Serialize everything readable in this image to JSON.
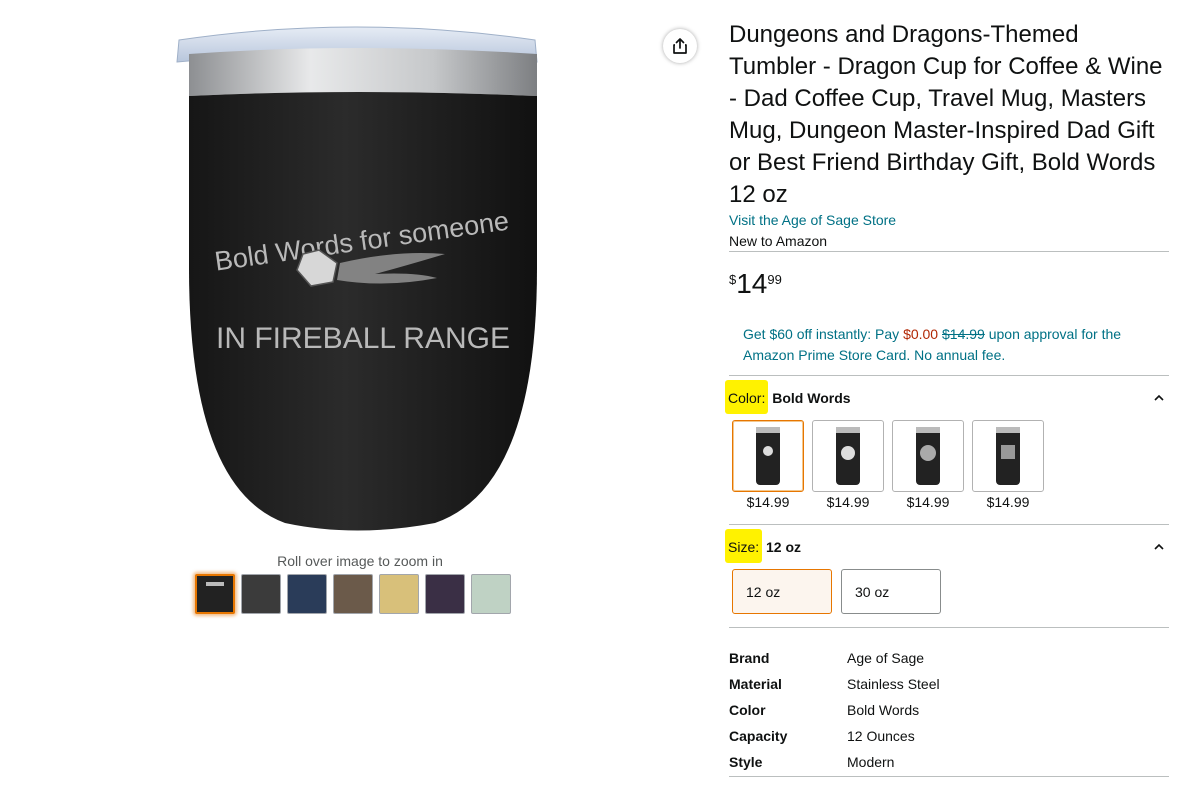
{
  "product": {
    "title": "Dungeons and Dragons-Themed Tumbler - Dragon Cup for Coffee & Wine - Dad Coffee Cup, Travel Mug, Masters Mug, Dungeon Master-Inspired Dad Gift or Best Friend Birthday Gift, Bold Words 12 oz",
    "store_link": "Visit the Age of Sage Store",
    "new_to": "New to Amazon",
    "image_text_line1": "Bold Words for someone",
    "image_text_line2": "IN FIREBALL RANGE",
    "zoom_hint": "Roll over image to zoom in",
    "thumbnail_count": 7,
    "selected_thumbnail": 1
  },
  "price": {
    "symbol": "$",
    "whole": "14",
    "fraction": "99"
  },
  "promo": {
    "text1": "Get $60 off instantly: Pay ",
    "zero": "$0.00",
    "strike": "$14.99",
    "text2": " upon approval for the Amazon Prime Store Card. No annual fee."
  },
  "color": {
    "label": "Color:",
    "selected": "Bold Words",
    "options": [
      {
        "price": "$14.99",
        "selected": true
      },
      {
        "price": "$14.99",
        "selected": false
      },
      {
        "price": "$14.99",
        "selected": false
      },
      {
        "price": "$14.99",
        "selected": false
      }
    ]
  },
  "size": {
    "label": "Size:",
    "selected": "12 oz",
    "options": [
      "12 oz",
      "30 oz"
    ]
  },
  "specs": [
    {
      "key": "Brand",
      "value": "Age of Sage"
    },
    {
      "key": "Material",
      "value": "Stainless Steel"
    },
    {
      "key": "Color",
      "value": "Bold Words"
    },
    {
      "key": "Capacity",
      "value": "12 Ounces"
    },
    {
      "key": "Style",
      "value": "Modern"
    }
  ],
  "colors": {
    "link": "#007185",
    "accent": "#e77600",
    "deal": "#B12704",
    "highlight": "#fff200"
  },
  "icons": [
    "share-icon",
    "chevron-up-icon"
  ]
}
